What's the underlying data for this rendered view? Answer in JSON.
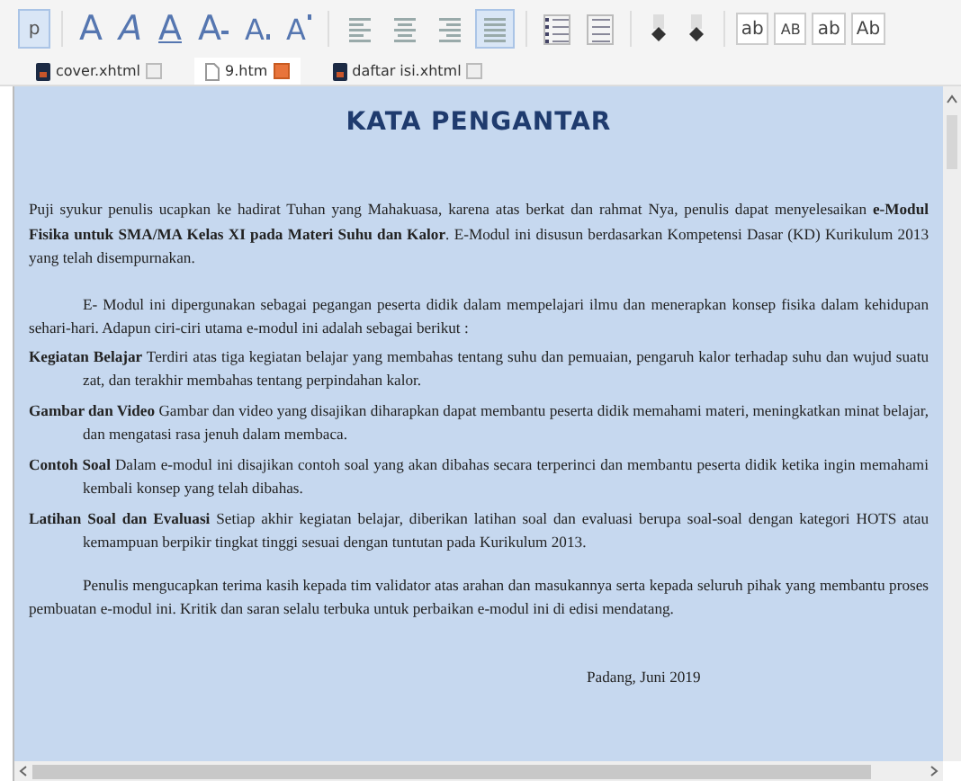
{
  "toolbar": {
    "paragraph_button": {
      "label": "p",
      "selected": true
    },
    "text_styles": [
      {
        "label": "A",
        "kind": "large"
      },
      {
        "label": "A",
        "kind": "italic"
      },
      {
        "label": "A",
        "kind": "underline"
      },
      {
        "label": "A",
        "kind": "strike"
      },
      {
        "label": "A",
        "kind": "subscript"
      },
      {
        "label": "A",
        "kind": "superscript"
      }
    ],
    "alignment": [
      {
        "selected": false
      },
      {
        "selected": false
      },
      {
        "selected": false
      },
      {
        "selected": true
      }
    ],
    "case_buttons": [
      {
        "label": "ab",
        "kind": "lower"
      },
      {
        "label": "AB",
        "kind": "upper"
      },
      {
        "label": "ab",
        "kind": "lower"
      },
      {
        "label": "Ab",
        "kind": "title"
      }
    ]
  },
  "tabs": [
    {
      "label": "cover.xhtml",
      "selected": false
    },
    {
      "label": "9.htm",
      "selected": true
    },
    {
      "label": "daftar isi.xhtml",
      "selected": false
    }
  ],
  "document": {
    "title": "KATA PENGANTAR",
    "paragraphs": [
      {
        "kind": "plain",
        "text": "Puji syukur penulis ucapkan ke hadirat Tuhan yang Mahakuasa, karena atas berkat dan rahmat Nya, penulis dapat menyelesaikan **e-Modul Fisika untuk SMA/MA Kelas XI pada Materi Suhu dan Kalor**. E-Modul ini disusun berdasarkan Kompetensi Dasar (KD) Kurikulum 2013 yang telah disempurnakan."
      },
      {
        "kind": "indent",
        "text": "E- Modul ini dipergunakan sebagai pegangan peserta didik dalam mempelajari ilmu dan menerapkan konsep fisika dalam kehidupan sehari-hari. Adapun ciri-ciri utama e-modul ini adalah sebagai berikut :"
      },
      {
        "kind": "item",
        "text": "**Kegiatan Belajar** Terdiri atas tiga kegiatan belajar yang membahas tentang suhu dan pemuaian, pengaruh kalor terhadap suhu dan wujud suatu zat, dan terakhir membahas tentang perpindahan kalor."
      },
      {
        "kind": "item",
        "text": "**Gambar dan Video** Gambar dan video yang disajikan diharapkan dapat membantu peserta didik memahami materi, meningkatkan minat belajar, dan mengatasi rasa jenuh dalam membaca."
      },
      {
        "kind": "item",
        "text": "**Contoh Soal** Dalam e-modul ini disajikan contoh soal yang akan dibahas secara terperinci dan membantu peserta didik ketika ingin memahami kembali konsep yang telah dibahas."
      },
      {
        "kind": "item",
        "text": "**Latihan Soal dan Evaluasi** Setiap akhir kegiatan belajar, diberikan latihan soal dan evaluasi berupa soal-soal dengan kategori HOTS atau kemampuan berpikir tingkat tinggi sesuai dengan tuntutan pada Kurikulum 2013."
      },
      {
        "kind": "indent",
        "text": "Penulis mengucapkan terima kasih kepada tim validator atas arahan dan masukannya serta kepada seluruh pihak yang membantu proses pembuatan e-modul ini. Kritik dan saran selalu terbuka untuk perbaikan e-modul ini di edisi mendatang."
      },
      {
        "kind": "signature",
        "text": "Padang,  Juni 2019"
      }
    ]
  }
}
